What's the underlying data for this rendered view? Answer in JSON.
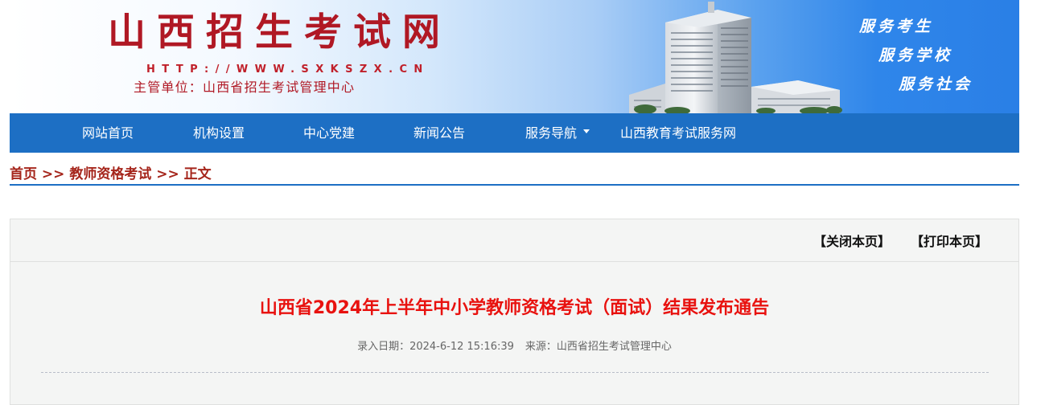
{
  "header": {
    "site_title": "山西招生考试网",
    "site_url": "HTTP://WWW.SXKSZX.CN",
    "admin_unit": "主管单位：山西省招生考试管理中心",
    "slogans": [
      "服务考生",
      "服务学校",
      "服务社会"
    ]
  },
  "nav": {
    "items": [
      {
        "label": "网站首页"
      },
      {
        "label": "机构设置"
      },
      {
        "label": "中心党建"
      },
      {
        "label": "新闻公告"
      },
      {
        "label": "服务导航",
        "has_dropdown": true
      },
      {
        "label": "山西教育考试服务网"
      }
    ]
  },
  "breadcrumb": {
    "home": "首页",
    "separator": " >> ",
    "section": "教师资格考试",
    "current": "正文"
  },
  "toolbar": {
    "close_label": "【关闭本页】",
    "print_label": "【打印本页】"
  },
  "article": {
    "title": "山西省2024年上半年中小学教师资格考试（面试）结果发布通告",
    "date_label": "录入日期：",
    "date": "2024-6-12 15:16:39",
    "source_label": "来源：",
    "source": "山西省招生考试管理中心"
  },
  "colors": {
    "nav_bg": "#1d6fc4",
    "title_red": "#e8120f",
    "breadcrumb_red": "#a5251b",
    "banner_blue": "#2a7fe6"
  }
}
